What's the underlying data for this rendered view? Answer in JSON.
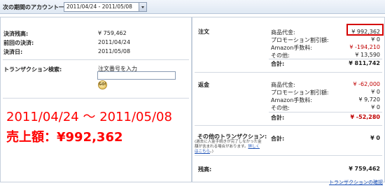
{
  "topbar": {
    "label": "次の期間のアカウント一覧",
    "period_value": "2011/04/24 - 2011/05/08"
  },
  "summary": {
    "balance_label": "決済残高:",
    "balance_value": "¥ 759,462",
    "prev_settlement_label": "前回の決済:",
    "prev_settlement_value": "2011/04/24",
    "settlement_date_label": "決済日:",
    "settlement_date_value": "2011/05/08"
  },
  "search": {
    "label": "トランザクション検索:",
    "input_label": "注文番号を入力",
    "input_value": "",
    "go_label": "GO!"
  },
  "overlay": {
    "date_range": "2011/04/24 ～ 2011/05/08",
    "sales": "売上額：¥992,362"
  },
  "orders": {
    "title": "注文",
    "rows": [
      {
        "label": "商品代金:",
        "value": "¥ 992,362"
      },
      {
        "label": "プロモーション割引額:",
        "value": "¥ 0"
      },
      {
        "label": "Amazon手数料:",
        "value": "¥ -194,210"
      },
      {
        "label": "その他:",
        "value": "¥ 13,590"
      }
    ],
    "total_label": "合計:",
    "total_value": "¥ 811,742"
  },
  "refunds": {
    "title": "返金",
    "rows": [
      {
        "label": "商品代金:",
        "value": "¥ -62,000"
      },
      {
        "label": "プロモーション割引額:",
        "value": "¥ 0"
      },
      {
        "label": "Amazon手数料:",
        "value": "¥ 9,720"
      },
      {
        "label": "その他:",
        "value": "¥ 0"
      }
    ],
    "total_label": "合計:",
    "total_value": "¥ -52,280"
  },
  "other": {
    "title": "その他のトランザクション:",
    "total_label": "合計:",
    "total_value": "¥ 0",
    "note_text": "(過去に入金手続きが完了しなかった金額が含まれる場合があります。",
    "note_link": "詳しくはこちら",
    "note_end": "。)"
  },
  "balance": {
    "label": "残高:",
    "value": "¥ 759,462"
  },
  "footer": {
    "confirm_link": "トランザクションの確認"
  },
  "colors": {
    "accent_red": "#ff0000",
    "negative_red": "#c00000",
    "link_blue": "#1a4fb5"
  }
}
